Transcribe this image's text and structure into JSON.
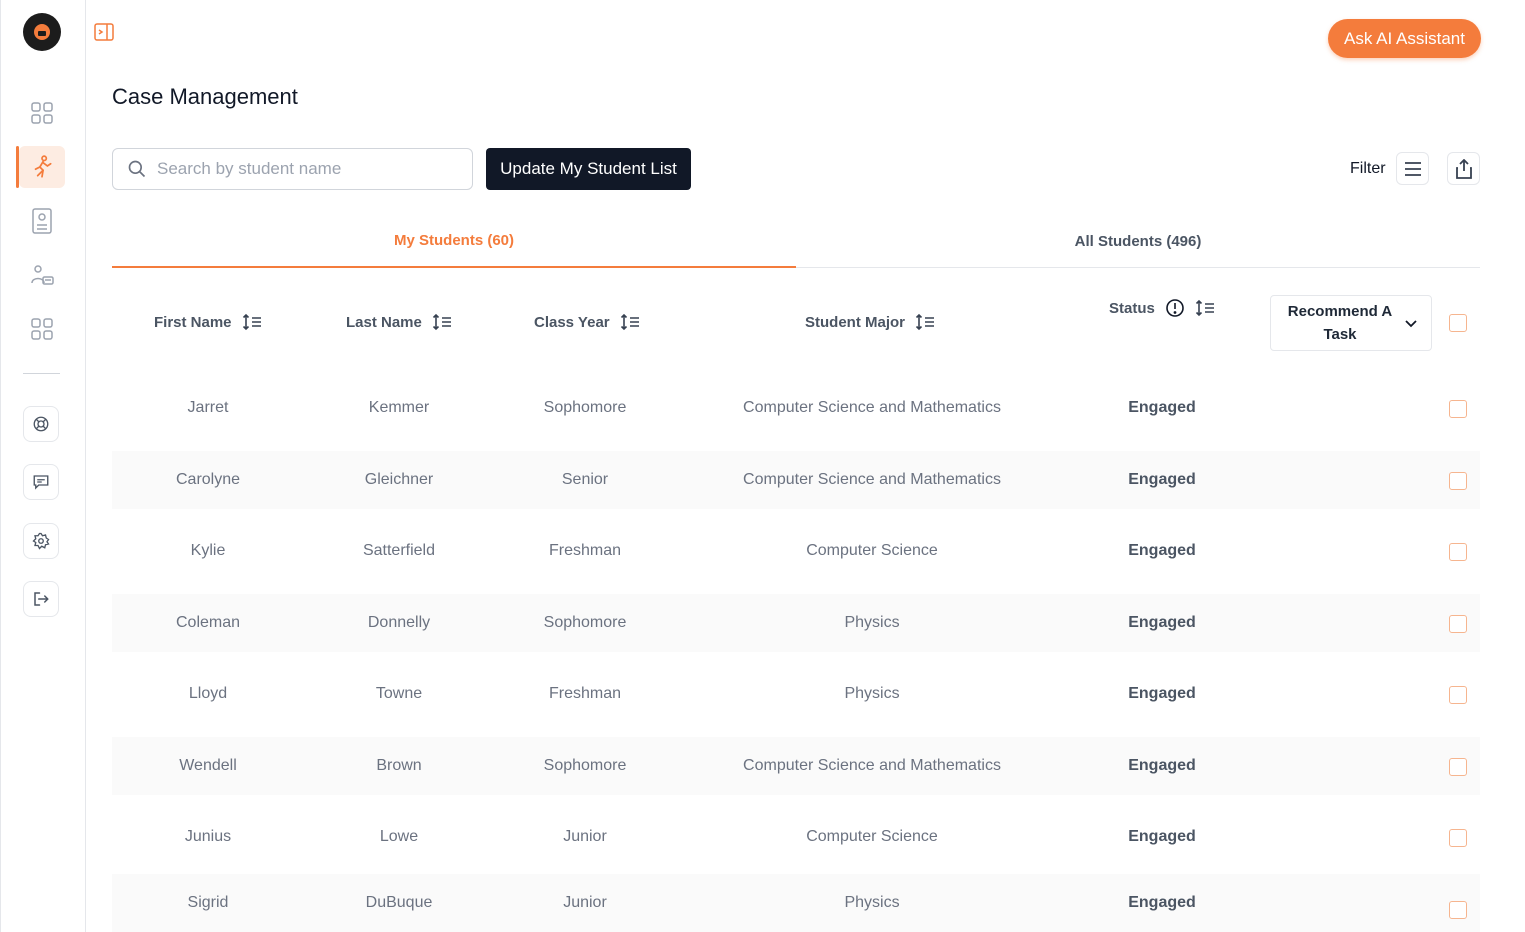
{
  "header": {
    "title": "Case Management",
    "ask_ai_label": "Ask AI Assistant"
  },
  "sidebar": {
    "items": [
      {
        "name": "dashboard",
        "icon": "grid-icon"
      },
      {
        "name": "case-management",
        "icon": "running-person-icon",
        "active": true
      },
      {
        "name": "student-profile",
        "icon": "id-card-icon"
      },
      {
        "name": "groups",
        "icon": "people-icon"
      },
      {
        "name": "apps",
        "icon": "grid-icon"
      }
    ],
    "bottom": [
      {
        "name": "help",
        "icon": "lifebuoy-icon"
      },
      {
        "name": "messages",
        "icon": "chat-icon"
      },
      {
        "name": "settings",
        "icon": "gear-icon"
      },
      {
        "name": "logout",
        "icon": "logout-icon"
      }
    ]
  },
  "toolbar": {
    "search_placeholder": "Search by student name",
    "update_label": "Update My Student List",
    "filter_label": "Filter"
  },
  "tabs": [
    {
      "label": "My Students (60)",
      "active": true
    },
    {
      "label": "All Students (496)",
      "active": false
    }
  ],
  "table": {
    "columns": {
      "first_name": "First Name",
      "last_name": "Last Name",
      "class_year": "Class Year",
      "major": "Student Major",
      "status": "Status",
      "recommend": "Recommend A Task"
    },
    "rows": [
      {
        "first": "Jarret",
        "last": "Kemmer",
        "year": "Sophomore",
        "major": "Computer Science and Mathematics",
        "status": "Engaged"
      },
      {
        "first": "Carolyne",
        "last": "Gleichner",
        "year": "Senior",
        "major": "Computer Science and Mathematics",
        "status": "Engaged"
      },
      {
        "first": "Kylie",
        "last": "Satterfield",
        "year": "Freshman",
        "major": "Computer Science",
        "status": "Engaged"
      },
      {
        "first": "Coleman",
        "last": "Donnelly",
        "year": "Sophomore",
        "major": "Physics",
        "status": "Engaged"
      },
      {
        "first": "Lloyd",
        "last": "Towne",
        "year": "Freshman",
        "major": "Physics",
        "status": "Engaged"
      },
      {
        "first": "Wendell",
        "last": "Brown",
        "year": "Sophomore",
        "major": "Computer Science and Mathematics",
        "status": "Engaged"
      },
      {
        "first": "Junius",
        "last": "Lowe",
        "year": "Junior",
        "major": "Computer Science",
        "status": "Engaged"
      },
      {
        "first": "Sigrid",
        "last": "DuBuque",
        "year": "Junior",
        "major": "Physics",
        "status": "Engaged"
      }
    ]
  },
  "colors": {
    "accent": "#f47c3c",
    "dark_button": "#111827",
    "checkbox_border": "#f6b58f"
  }
}
